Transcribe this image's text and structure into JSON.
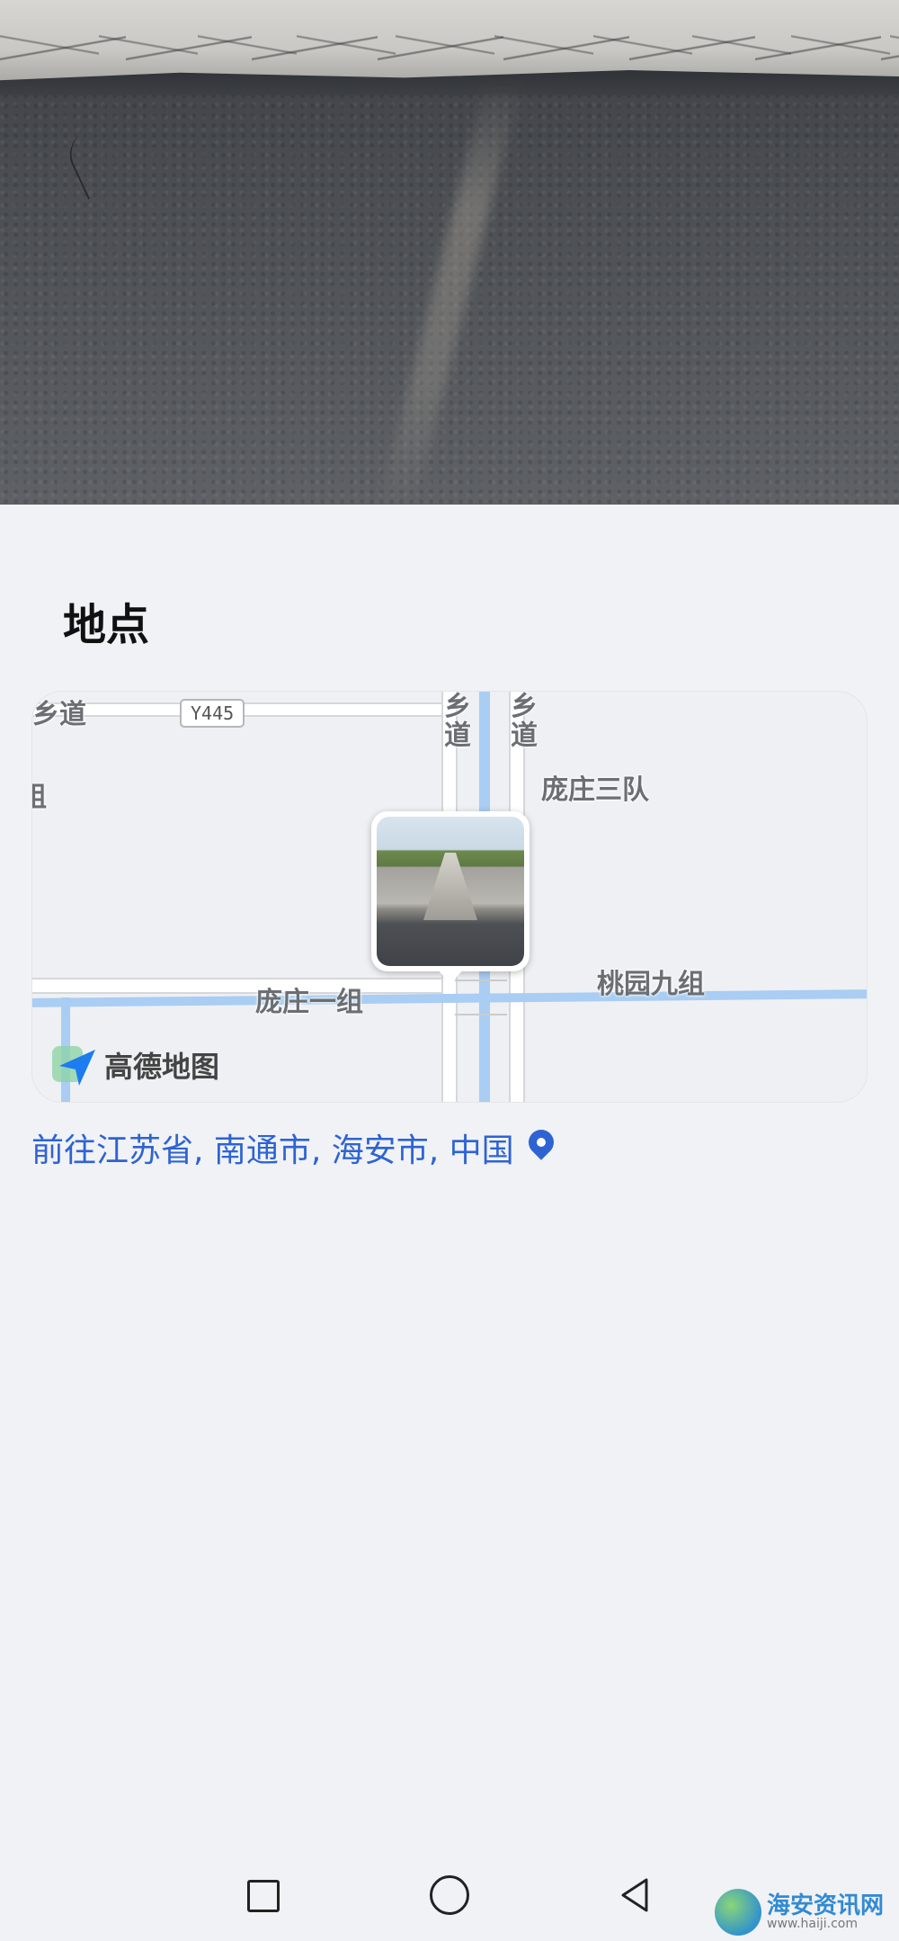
{
  "section": {
    "title": "地点"
  },
  "map": {
    "provider_logo_text": "高德地图",
    "road_shield": "Y445",
    "labels": {
      "xiangdao_left": "乡道",
      "xiangdao_v1": "乡道",
      "xiangdao_v2": "乡道",
      "group_left": "组",
      "pangzhuang_sandui": "庞庄三队",
      "pangzhuang_yizu": "庞庄一组",
      "taoyuan_jiuzu": "桃园九组"
    }
  },
  "location": {
    "link_text": "前往江苏省, 南通市, 海安市, 中国",
    "icon": "location-pin-icon"
  },
  "navbar": {
    "recents_icon": "square-icon",
    "home_icon": "circle-icon",
    "back_icon": "triangle-back-icon"
  },
  "watermark": {
    "title": "海安资讯网",
    "url": "www.haiji.com"
  },
  "colors": {
    "background": "#f0f2f5",
    "link": "#2e63d2",
    "water": "#a9cdf3"
  }
}
